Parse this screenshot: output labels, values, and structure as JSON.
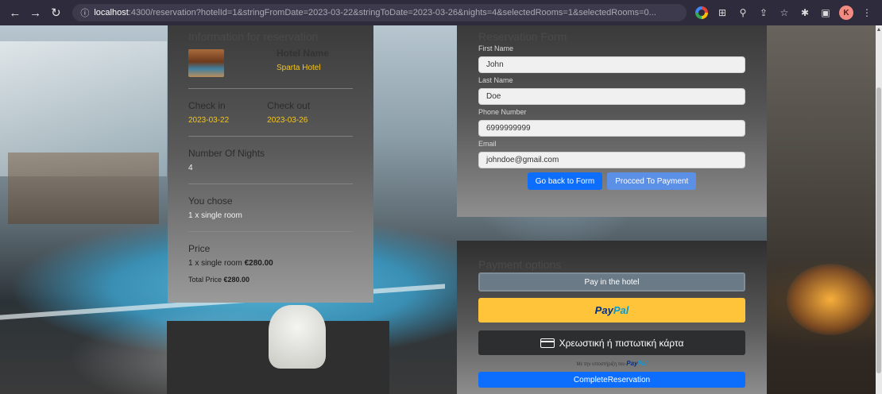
{
  "browser": {
    "url_host": "localhost",
    "url_path": ":4300/reservation?hotelId=1&stringFromDate=2023-03-22&stringToDate=2023-03-26&nights=4&selectedRooms=1&selectedRooms=0...",
    "avatar_letter": "K"
  },
  "info": {
    "title": "Information for reservation",
    "hotel_label": "Hotel Name",
    "hotel_name": "Sparta Hotel",
    "check_in_label": "Check in",
    "check_in_value": "2023-03-22",
    "check_out_label": "Check out",
    "check_out_value": "2023-03-26",
    "nights_label": "Number Of Nights",
    "nights_value": "4",
    "chose_label": "You chose",
    "chose_value": "1 x single room",
    "price_label": "Price",
    "price_line_prefix": "1 x single room ",
    "price_line_amount": "€280.00",
    "total_prefix": "Total Price ",
    "total_amount": "€280.00"
  },
  "form": {
    "title": "Reservation Form",
    "first_name_label": "First Name",
    "first_name_value": "John",
    "last_name_label": "Last Name",
    "last_name_value": "Doe",
    "phone_label": "Phone Number",
    "phone_value": "6999999999",
    "email_label": "Email",
    "email_value": "johndoe@gmail.com",
    "back_button": "Go back to Form",
    "payment_button": "Procced To Payment"
  },
  "payment": {
    "title": "Payment options",
    "pay_hotel": "Pay in the hotel",
    "paypal_pay": "Pay",
    "paypal_pal": "Pal",
    "card_label": "Χρεωστική ή πιστωτική κάρτα",
    "powered_text": "Με την υποστήριξη του ",
    "powered_pay": "Pay",
    "powered_pal": "Pal",
    "complete_button": "CompleteReservation"
  },
  "colors": {
    "accent": "#f5c518",
    "primary": "#0d6efd",
    "paypal_yellow": "#ffc439"
  }
}
